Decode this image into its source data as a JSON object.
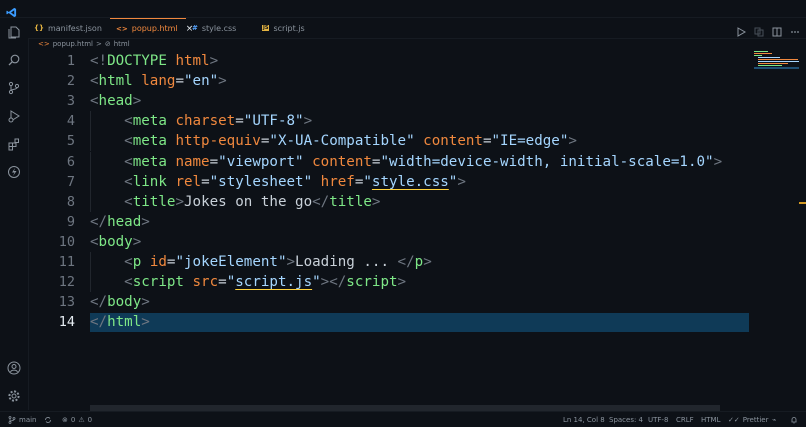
{
  "editor": {
    "tabs": [
      {
        "icon": "{}",
        "label": "manifest.json",
        "active": false
      },
      {
        "icon": "<>",
        "label": "popup.html",
        "active": true,
        "close": "×"
      },
      {
        "icon": "#",
        "label": "style.css",
        "active": false
      },
      {
        "icon": "JS",
        "label": "script.js",
        "active": false
      }
    ],
    "breadcrumb": {
      "file": "popup.html",
      "separator": ">",
      "node": "html"
    },
    "lines": [
      {
        "n": "1",
        "tokens": [
          [
            "p",
            "<!"
          ],
          [
            "t",
            "DOCTYPE"
          ],
          [
            "x",
            " "
          ],
          [
            "a",
            "html"
          ],
          [
            "p",
            ">"
          ]
        ]
      },
      {
        "n": "2",
        "tokens": [
          [
            "p",
            "<"
          ],
          [
            "t",
            "html"
          ],
          [
            "x",
            " "
          ],
          [
            "a",
            "lang"
          ],
          [
            "x",
            "="
          ],
          [
            "s",
            "\"en\""
          ],
          [
            "p",
            ">"
          ]
        ]
      },
      {
        "n": "3",
        "tokens": [
          [
            "p",
            "<"
          ],
          [
            "t",
            "head"
          ],
          [
            "p",
            ">"
          ]
        ]
      },
      {
        "n": "4",
        "tokens": [
          [
            "x",
            "    "
          ],
          [
            "p",
            "<"
          ],
          [
            "t",
            "meta"
          ],
          [
            "x",
            " "
          ],
          [
            "a",
            "charset"
          ],
          [
            "x",
            "="
          ],
          [
            "s",
            "\"UTF-8\""
          ],
          [
            "p",
            ">"
          ]
        ]
      },
      {
        "n": "5",
        "tokens": [
          [
            "x",
            "    "
          ],
          [
            "p",
            "<"
          ],
          [
            "t",
            "meta"
          ],
          [
            "x",
            " "
          ],
          [
            "a",
            "http-equiv"
          ],
          [
            "x",
            "="
          ],
          [
            "s",
            "\"X-UA-Compatible\""
          ],
          [
            "x",
            " "
          ],
          [
            "a",
            "content"
          ],
          [
            "x",
            "="
          ],
          [
            "s",
            "\"IE=edge\""
          ],
          [
            "p",
            ">"
          ]
        ]
      },
      {
        "n": "6",
        "tokens": [
          [
            "x",
            "    "
          ],
          [
            "p",
            "<"
          ],
          [
            "t",
            "meta"
          ],
          [
            "x",
            " "
          ],
          [
            "a",
            "name"
          ],
          [
            "x",
            "="
          ],
          [
            "s",
            "\"viewport\""
          ],
          [
            "x",
            " "
          ],
          [
            "a",
            "content"
          ],
          [
            "x",
            "="
          ],
          [
            "s",
            "\"width=device-width, initial-scale=1.0\""
          ],
          [
            "p",
            ">"
          ]
        ]
      },
      {
        "n": "7",
        "tokens": [
          [
            "x",
            "    "
          ],
          [
            "p",
            "<"
          ],
          [
            "t",
            "link"
          ],
          [
            "x",
            " "
          ],
          [
            "a",
            "rel"
          ],
          [
            "x",
            "="
          ],
          [
            "s",
            "\"stylesheet\""
          ],
          [
            "x",
            " "
          ],
          [
            "a",
            "href"
          ],
          [
            "x",
            "="
          ],
          [
            "s",
            "\""
          ],
          [
            "su",
            "style.css"
          ],
          [
            "s",
            "\""
          ],
          [
            "p",
            ">"
          ]
        ]
      },
      {
        "n": "8",
        "tokens": [
          [
            "x",
            "    "
          ],
          [
            "p",
            "<"
          ],
          [
            "t",
            "title"
          ],
          [
            "p",
            ">"
          ],
          [
            "x",
            "Jokes on the go"
          ],
          [
            "p",
            "</"
          ],
          [
            "t",
            "title"
          ],
          [
            "p",
            ">"
          ]
        ]
      },
      {
        "n": "9",
        "tokens": [
          [
            "p",
            "</"
          ],
          [
            "t",
            "head"
          ],
          [
            "p",
            ">"
          ]
        ]
      },
      {
        "n": "10",
        "tokens": [
          [
            "p",
            "<"
          ],
          [
            "t",
            "body"
          ],
          [
            "p",
            ">"
          ]
        ]
      },
      {
        "n": "11",
        "tokens": [
          [
            "x",
            "    "
          ],
          [
            "p",
            "<"
          ],
          [
            "t",
            "p"
          ],
          [
            "x",
            " "
          ],
          [
            "a",
            "id"
          ],
          [
            "x",
            "="
          ],
          [
            "s",
            "\"jokeElement\""
          ],
          [
            "p",
            ">"
          ],
          [
            "x",
            "Loading ... "
          ],
          [
            "p",
            "</"
          ],
          [
            "t",
            "p"
          ],
          [
            "p",
            ">"
          ]
        ]
      },
      {
        "n": "12",
        "tokens": [
          [
            "x",
            "    "
          ],
          [
            "p",
            "<"
          ],
          [
            "t",
            "script"
          ],
          [
            "x",
            " "
          ],
          [
            "a",
            "src"
          ],
          [
            "x",
            "="
          ],
          [
            "s",
            "\""
          ],
          [
            "su",
            "script.js"
          ],
          [
            "s",
            "\""
          ],
          [
            "p",
            "></"
          ],
          [
            "t",
            "script"
          ],
          [
            "p",
            ">"
          ]
        ]
      },
      {
        "n": "13",
        "tokens": [
          [
            "p",
            "</"
          ],
          [
            "t",
            "body"
          ],
          [
            "p",
            ">"
          ]
        ]
      },
      {
        "n": "14",
        "tokens": [
          [
            "p",
            "</"
          ],
          [
            "t",
            "html"
          ],
          [
            "p",
            ">"
          ]
        ]
      }
    ],
    "current_line": 14
  },
  "statusbar": {
    "branch": "main",
    "problems": "0",
    "warnings": "0",
    "cursor": "Ln 14, Col 8",
    "spaces": "Spaces: 4",
    "encoding": "UTF-8",
    "eol": "CRLF",
    "language": "HTML",
    "formatter": "Prettier"
  },
  "colors": {
    "background": "#0d1117",
    "accent": "#f0883e",
    "tag": "#7ee787",
    "attribute": "#f0883e",
    "string": "#a5d6ff",
    "current_line": "#0f3a57"
  }
}
